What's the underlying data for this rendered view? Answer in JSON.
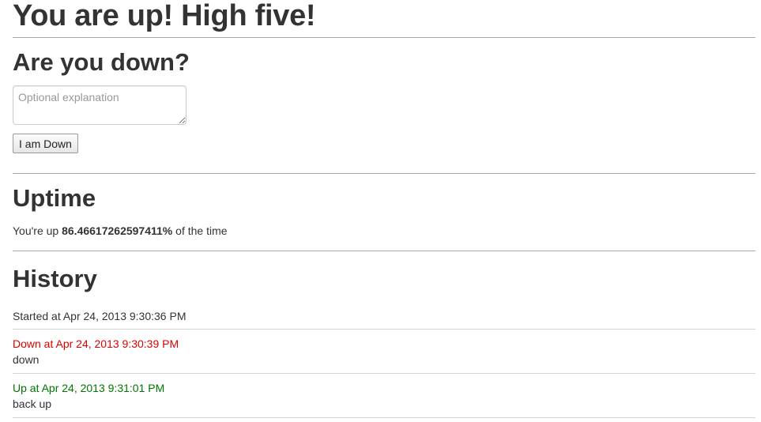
{
  "title": "You are up! High five!",
  "down_section": {
    "heading": "Are you down?",
    "explanation_placeholder": "Optional explanation",
    "explanation_value": "",
    "button_label": "I am Down"
  },
  "uptime_section": {
    "heading": "Uptime",
    "prefix": "You're up ",
    "percent": "86.46617262597411%",
    "suffix": " of the time"
  },
  "history_section": {
    "heading": "History",
    "started_text": "Started at Apr 24, 2013 9:30:36 PM",
    "entries": [
      {
        "status": "down",
        "heading": "Down at Apr 24, 2013 9:30:39 PM",
        "message": "down",
        "color": "#dd0000"
      },
      {
        "status": "up",
        "heading": "Up at Apr 24, 2013 9:31:01 PM",
        "message": "back up",
        "color": "#007700"
      }
    ]
  }
}
